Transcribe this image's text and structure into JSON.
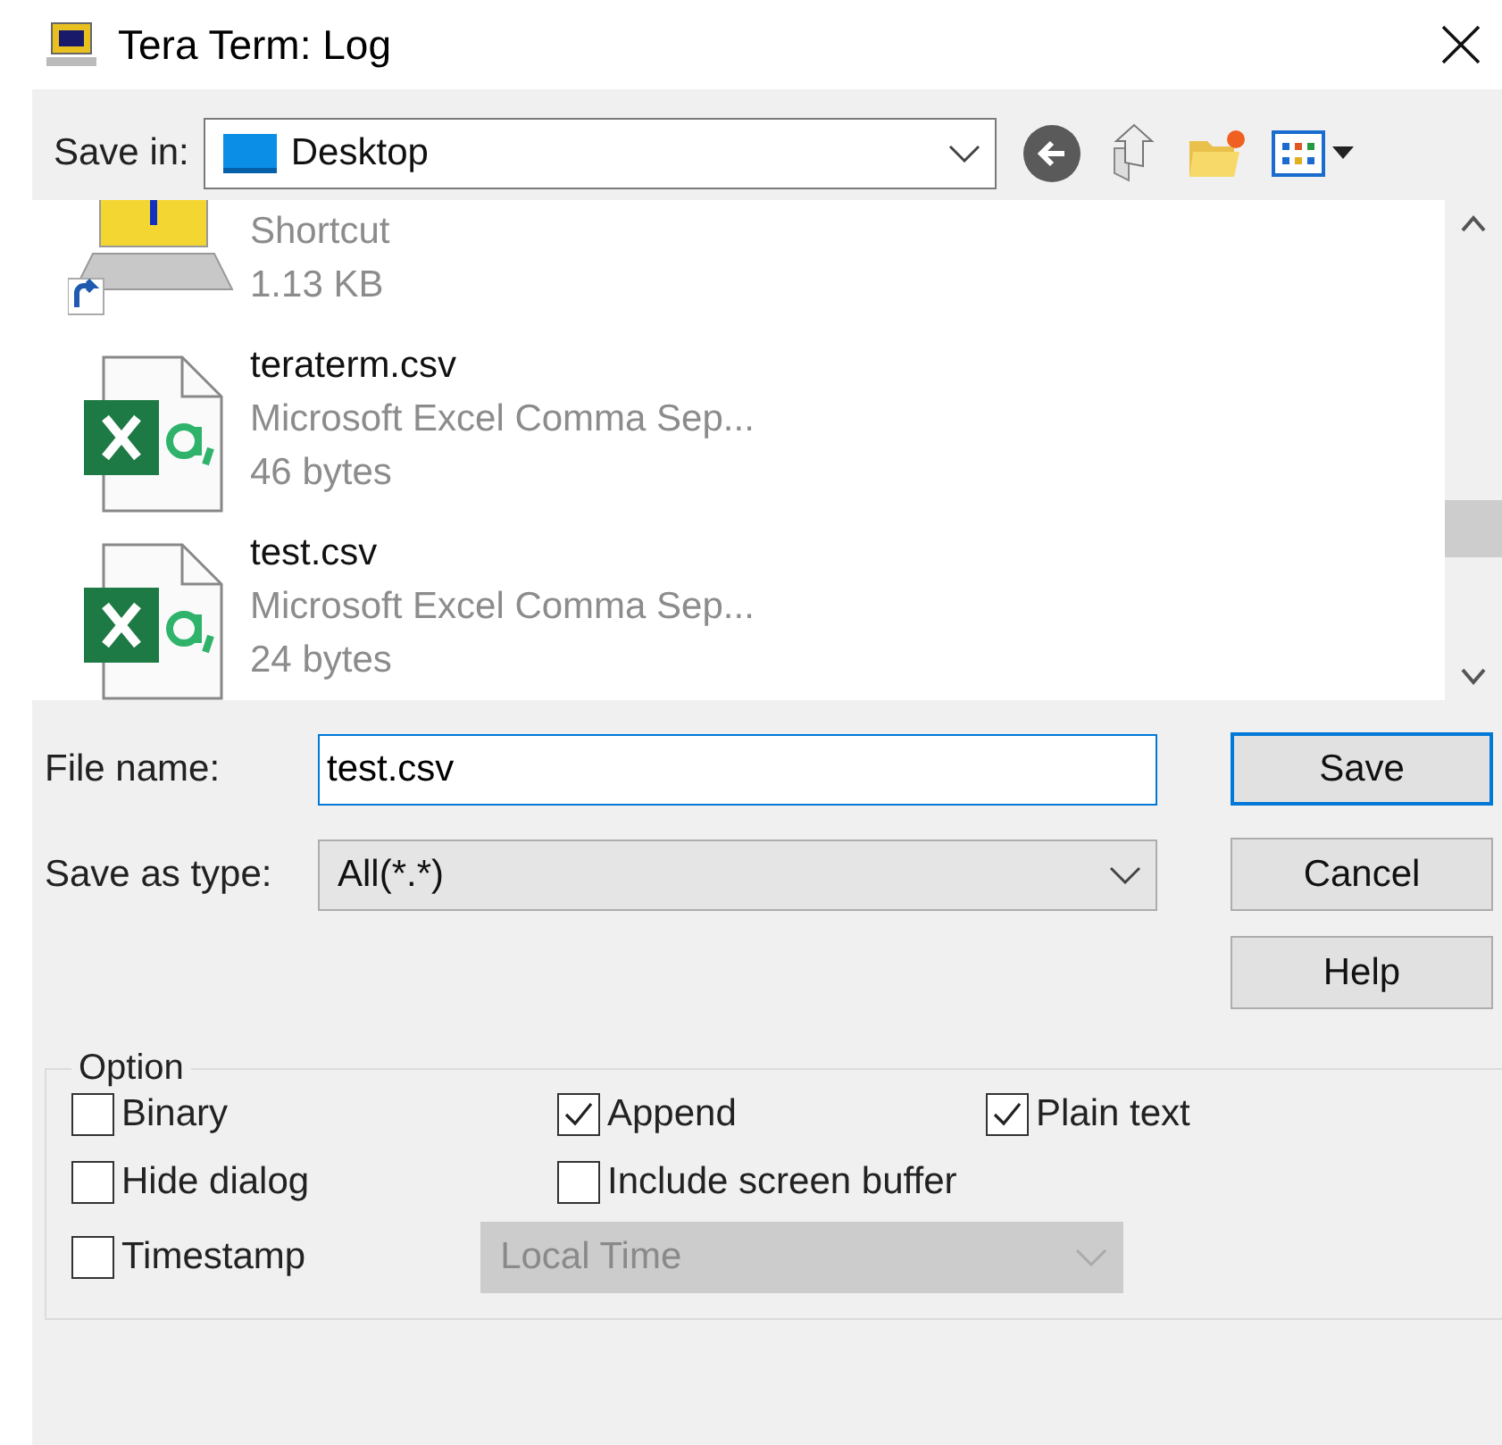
{
  "window": {
    "title": "Tera Term: Log"
  },
  "save_in": {
    "label": "Save in:",
    "value": "Desktop"
  },
  "files": [
    {
      "kind": "shortcut",
      "type": "Shortcut",
      "size": "1.13 KB"
    },
    {
      "kind": "excel",
      "name": "teraterm.csv",
      "type": "Microsoft Excel Comma Sep...",
      "size": "46 bytes"
    },
    {
      "kind": "excel",
      "name": "test.csv",
      "type": "Microsoft Excel Comma Sep...",
      "size": "24 bytes"
    }
  ],
  "file_name": {
    "label": "File name:",
    "value": "test.csv"
  },
  "save_as_type": {
    "label": "Save as type:",
    "value": "All(*.*)"
  },
  "buttons": [
    {
      "label": "Save",
      "default": true
    },
    {
      "label": "Cancel",
      "default": false
    },
    {
      "label": "Help",
      "default": false
    }
  ],
  "option": {
    "title": "Option",
    "checkboxes": [
      {
        "label": "Binary",
        "checked": false
      },
      {
        "label": "Append",
        "checked": true
      },
      {
        "label": "Plain text",
        "checked": true
      },
      {
        "label": "Hide dialog",
        "checked": false
      },
      {
        "label": "Include screen buffer",
        "checked": false
      },
      {
        "label": "Timestamp",
        "checked": false
      }
    ],
    "timestamp_format": {
      "value": "Local Time",
      "disabled": true
    }
  }
}
